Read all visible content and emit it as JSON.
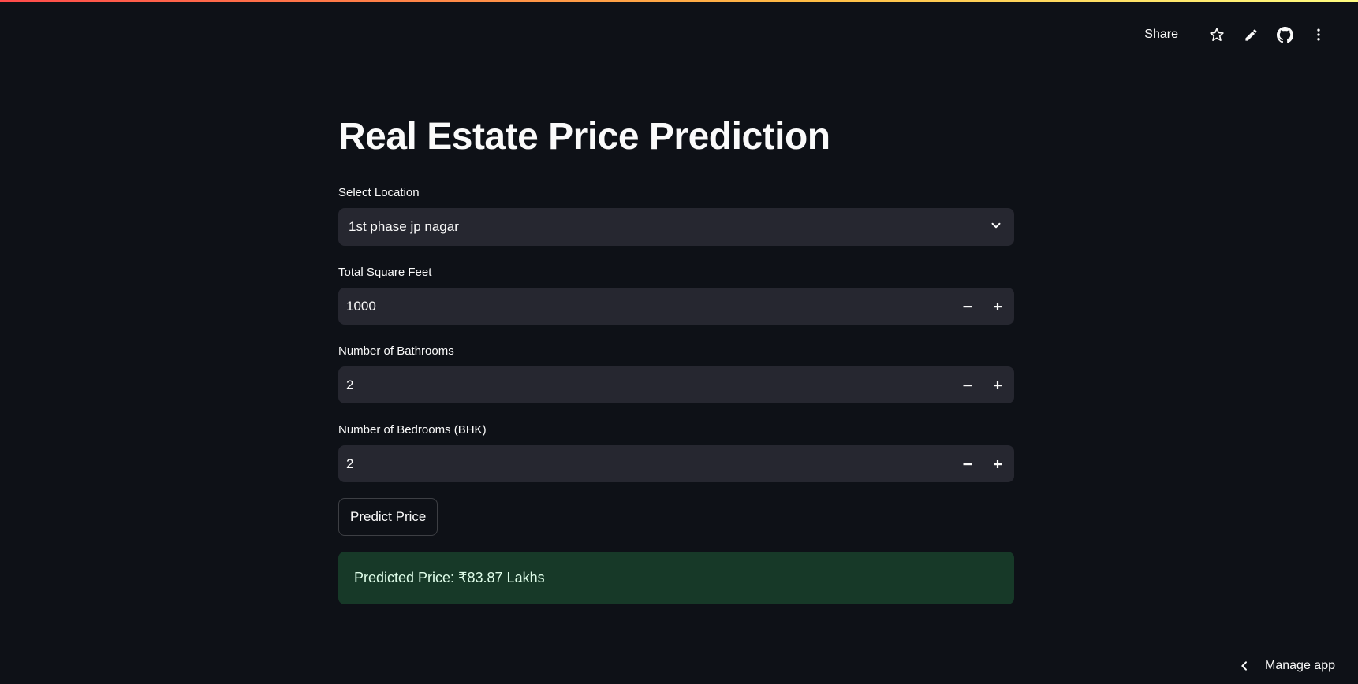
{
  "toolbar": {
    "share_label": "Share"
  },
  "title": "Real Estate Price Prediction",
  "fields": {
    "location": {
      "label": "Select Location",
      "value": "1st phase jp nagar"
    },
    "sqft": {
      "label": "Total Square Feet",
      "value": "1000"
    },
    "bath": {
      "label": "Number of Bathrooms",
      "value": "2"
    },
    "bhk": {
      "label": "Number of Bedrooms (BHK)",
      "value": "2"
    }
  },
  "predict_button": "Predict Price",
  "result": "Predicted Price: ₹83.87 Lakhs",
  "manage_app": "Manage app",
  "colors": {
    "background": "#0e1117",
    "input_bg": "#262730",
    "success_bg": "#173928",
    "success_text": "#dffde9"
  },
  "icons": [
    "star-icon",
    "edit-icon",
    "github-icon",
    "more-vertical-icon",
    "chevron-down-icon",
    "minus-icon",
    "plus-icon",
    "chevron-left-icon"
  ]
}
